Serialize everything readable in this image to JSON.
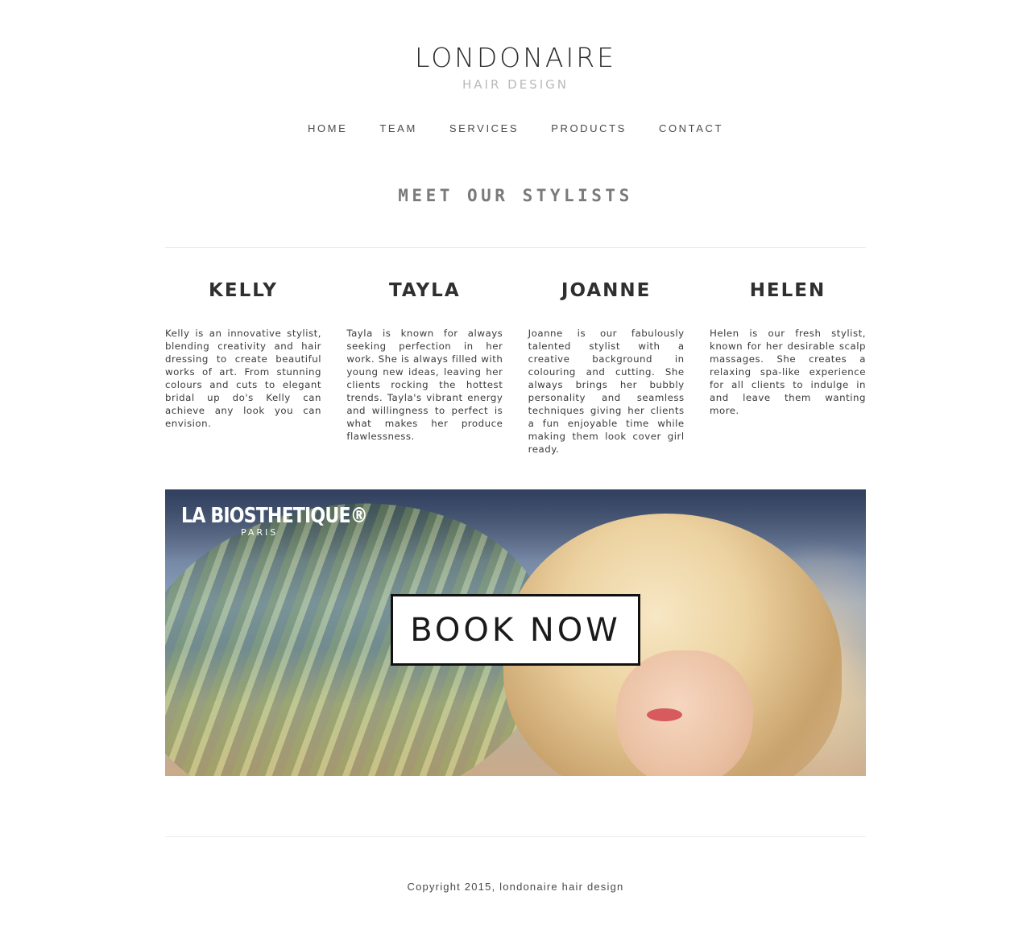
{
  "header": {
    "brand_name": "LONDONAIRE",
    "brand_sub": "HAIR DESIGN"
  },
  "nav": {
    "items": [
      {
        "label": "HOME"
      },
      {
        "label": "TEAM"
      },
      {
        "label": "SERVICES"
      },
      {
        "label": "PRODUCTS"
      },
      {
        "label": "CONTACT"
      }
    ]
  },
  "main": {
    "section_title": "MEET OUR STYLISTS",
    "stylists": [
      {
        "name": "KELLY",
        "bio": "Kelly is an innovative stylist, blending creativity and hair dressing to create beautiful works of art. From stunning colours and cuts to elegant bridal up do's Kelly can achieve any look you can envision."
      },
      {
        "name": "TAYLA",
        "bio": "Tayla is known for always seeking perfection in her work. She is always filled with young new ideas, leaving her clients rocking the hottest trends. Tayla's vibrant energy and willingness to perfect is what makes her produce flawlessness."
      },
      {
        "name": "JOANNE",
        "bio": "Joanne is our fabulously talented stylist with a creative background in colouring and cutting. She always brings her bubbly personality and seamless techniques giving her clients a fun enjoyable time while making them look cover girl ready."
      },
      {
        "name": "HELEN",
        "bio": "Helen is our fresh stylist, known for her desirable scalp massages. She creates a relaxing spa-like experience for all clients to indulge in and leave them wanting more."
      }
    ],
    "banner": {
      "logo_main": "LA BIOSTHETIQUE®",
      "logo_sub": "PARIS",
      "button_label": "BOOK NOW"
    }
  },
  "footer": {
    "copyright": "Copyright 2015, londonaire hair design"
  }
}
